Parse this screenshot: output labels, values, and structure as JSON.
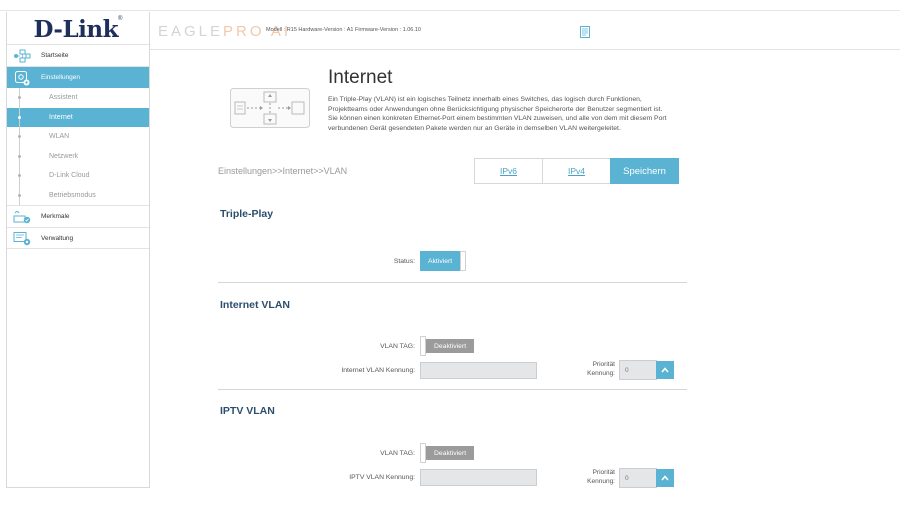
{
  "logo": {
    "text": "D-Link",
    "mark": "®"
  },
  "header": {
    "brand_main": "EAGLE",
    "brand_sub": "PRO AI",
    "model_info": "Modell : R15   Hardware-Version : A1   Firmware-Version : 1.06.10",
    "doc_icon": "document-icon"
  },
  "sidebar": {
    "home": {
      "label": "Startseite",
      "icon": "home-network-icon"
    },
    "settings": {
      "label": "Einstellungen",
      "icon": "settings-gear-icon"
    },
    "sub_items": [
      {
        "label": "Assistent"
      },
      {
        "label": "Internet"
      },
      {
        "label": "WLAN"
      },
      {
        "label": "Netzwerk"
      },
      {
        "label": "D-Link Cloud"
      },
      {
        "label": "Betriebsmodus"
      }
    ],
    "features": {
      "label": "Merkmale",
      "icon": "features-icon"
    },
    "management": {
      "label": "Verwaltung",
      "icon": "management-icon"
    }
  },
  "page": {
    "title": "Internet",
    "description": "Ein Triple-Play (VLAN) ist ein logisches Teilnetz innerhalb eines Switches, das logisch durch Funktionen, Projektteams oder Anwendungen ohne Berücksichtigung physischer Speicherorte der Benutzer segmentiert ist. Sie können einen konkreten Ethernet-Port einem bestimmten VLAN zuweisen, und alle von dem mit diesem Port verbundenen Gerät gesendeten Pakete werden nur an Geräte in demselben VLAN weitergeleitet.",
    "breadcrumb": "Einstellungen>>Internet>>VLAN",
    "tabs": {
      "ipv6": "IPv6",
      "ipv4": "IPv4",
      "save": "Speichern"
    }
  },
  "triple_play": {
    "title": "Triple-Play",
    "status_label": "Status:",
    "status_value": "Aktiviert"
  },
  "internet_vlan": {
    "title": "Internet VLAN",
    "tag_label": "VLAN TAG:",
    "tag_value": "Deaktiviert",
    "id_label": "Internet VLAN Kennung:",
    "id_value": "",
    "priority_label_1": "Priorität",
    "priority_label_2": "Kennung:",
    "priority_value": "0"
  },
  "iptv_vlan": {
    "title": "IPTV VLAN",
    "tag_label": "VLAN TAG:",
    "tag_value": "Deaktiviert",
    "id_label": "IPTV VLAN Kennung:",
    "id_value": "",
    "priority_label_1": "Priorität",
    "priority_label_2": "Kennung:",
    "priority_value": "0"
  },
  "colors": {
    "accent": "#5ab3d3",
    "section_title": "#2b4e6e",
    "logo": "#1f2f5c",
    "disabled": "#9b9b9b"
  }
}
